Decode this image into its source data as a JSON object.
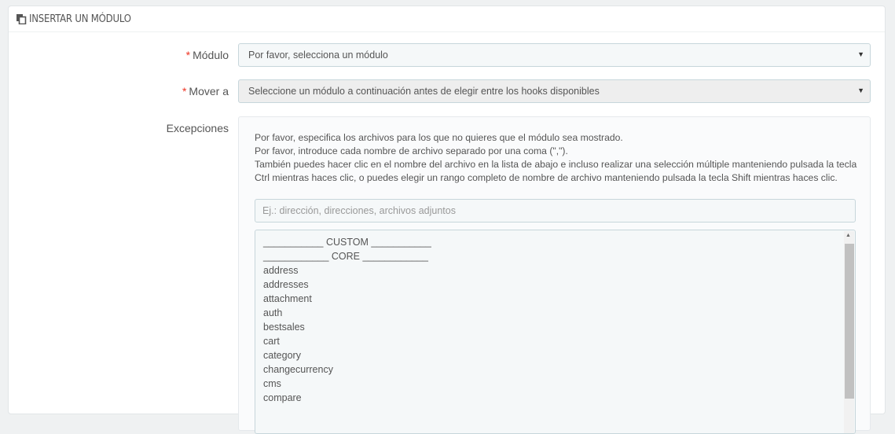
{
  "panel": {
    "title": "Insertar un módulo",
    "icon": "clone-icon"
  },
  "form": {
    "module": {
      "required_mark": "*",
      "label": "Módulo",
      "selected": "Por favor, selecciona un módulo"
    },
    "move_to": {
      "required_mark": "*",
      "label": "Mover a",
      "selected": "Seleccione un módulo a continuación antes de elegir entre los hooks disponibles"
    },
    "exceptions": {
      "label": "Excepciones",
      "help_lines": [
        "Por favor, especifica los archivos para los que no quieres que el módulo sea mostrado.",
        "Por favor, introduce cada nombre de archivo separado por una coma (\",\").",
        "También puedes hacer clic en el nombre del archivo en la lista de abajo e incluso realizar una selección múltiple manteniendo pulsada la tecla Ctrl mientras haces clic, o puedes elegir un rango completo de nombre de archivo manteniendo pulsada la tecla Shift mientras haces clic."
      ],
      "input_placeholder": "Ej.: dirección, direcciones, archivos adjuntos",
      "file_list": [
        "___________ CUSTOM ___________",
        "____________ CORE ____________",
        "address",
        "addresses",
        "attachment",
        "auth",
        "bestsales",
        "cart",
        "category",
        "changecurrency",
        "cms",
        "compare"
      ]
    }
  },
  "colors": {
    "required": "#ee3322",
    "page_bg": "#eff1f2",
    "field_bg": "#f5f8f9"
  }
}
